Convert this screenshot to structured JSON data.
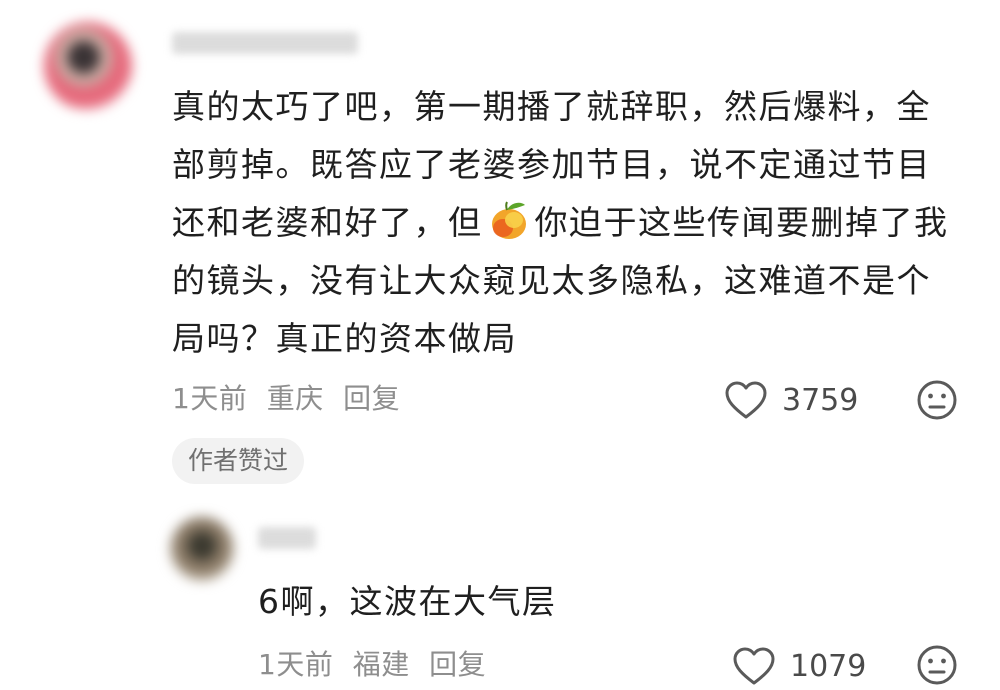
{
  "comment": {
    "text_part1": "真的太巧了吧，第一期播了就辞职，然后爆料，全部剪掉。既答应了老婆参加节目，说不定通过节目还和老婆和好了，但",
    "emoji": "mango-emoji",
    "text_part2": "你迫于这些传闻要删掉了我的镜头，没有让大众窥见太多隐私，这难道不是个局吗？真正的资本做局",
    "time": "1天前",
    "location": "重庆",
    "reply_label": "回复",
    "likes": "3759",
    "author_badge": "作者赞过"
  },
  "reply": {
    "text": "6啊，这波在大气层",
    "time": "1天前",
    "location": "福建",
    "reply_label": "回复",
    "likes": "1079"
  }
}
